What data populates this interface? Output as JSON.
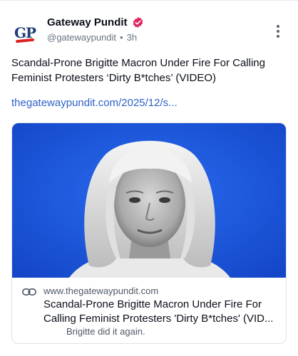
{
  "post": {
    "author_name": "Gateway Pundit",
    "handle": "@gatewaypundit",
    "separator": "•",
    "time": "3h",
    "avatar_text": "GP",
    "body_text": "Scandal-Prone Brigitte Macron Under Fire For Calling Feminist Protesters ‘Dirty B*tches’ (VIDEO)",
    "link_text": "thegatewaypundit.com/2025/12/s..."
  },
  "card": {
    "domain": "www.thegatewaypundit.com",
    "title": "Scandal-Prone Brigitte Macron Under Fire For Calling Feminist Protesters 'Dirty B*tches' (VID...",
    "description": "Brigitte did it again."
  },
  "icons": {
    "verified": "verified-badge-icon",
    "more": "more-vertical-icon",
    "link": "link-icon"
  },
  "colors": {
    "link": "#2f62c9",
    "verified": "#e0245e",
    "image_background": "#1b54d8"
  }
}
